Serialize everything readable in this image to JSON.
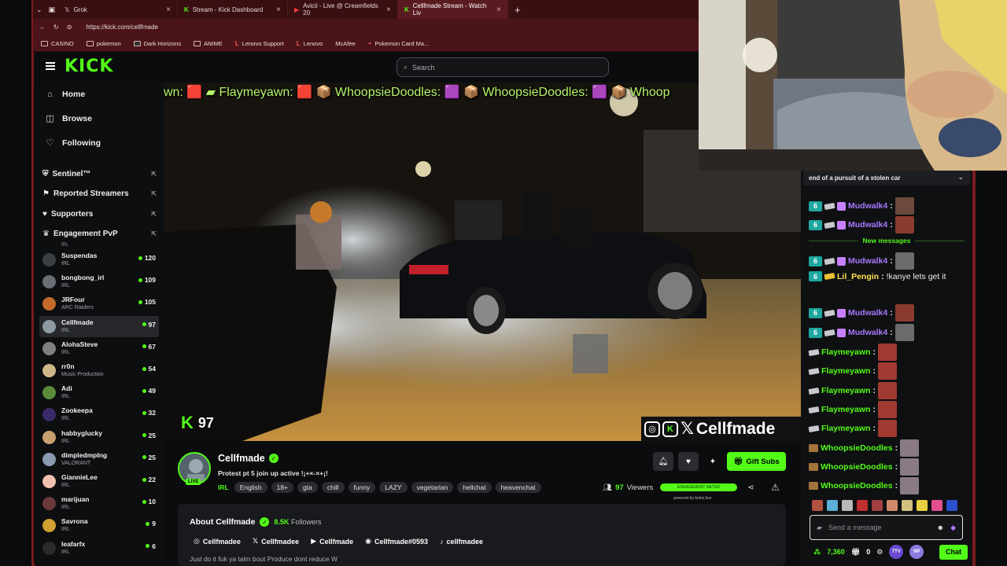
{
  "browser": {
    "tabs": [
      {
        "label": "Grok",
        "active": false
      },
      {
        "label": "Stream - Kick Dashboard",
        "active": false
      },
      {
        "label": "Avicii - Live @ Creamfields 20",
        "active": false
      },
      {
        "label": "Cellfmade Stream - Watch Liv",
        "active": true
      }
    ],
    "url": "https://kick.com/cellfmade",
    "bookmarks": [
      "CASINO",
      "pokemon",
      "Dark Horizons",
      "ANIME",
      "Lenovo Support",
      "Lenovo",
      "McAfee",
      "Pokemon Card Ma..."
    ]
  },
  "header": {
    "logo": "KICK",
    "search_placeholder": "Search"
  },
  "sidebar": {
    "nav": [
      {
        "label": "Home",
        "icon": "home-icon"
      },
      {
        "label": "Browse",
        "icon": "browse-icon"
      },
      {
        "label": "Following",
        "icon": "heart-icon"
      }
    ],
    "sections": [
      {
        "label": "Sentinel™"
      },
      {
        "label": "Reported Streamers"
      },
      {
        "label": "Supporters"
      },
      {
        "label": "Engagement PvP"
      }
    ],
    "partial_category": "IRL",
    "streamers": [
      {
        "name": "Suspendas",
        "category": "IRL",
        "viewers": "120"
      },
      {
        "name": "bongbong_irl",
        "category": "IRL",
        "viewers": "109"
      },
      {
        "name": "JRFour",
        "category": "ARC Raiders",
        "viewers": "105"
      },
      {
        "name": "Cellfmade",
        "category": "IRL",
        "viewers": "97"
      },
      {
        "name": "AlohaSteve",
        "category": "IRL",
        "viewers": "67"
      },
      {
        "name": "rr0n",
        "category": "Music Production",
        "viewers": "54"
      },
      {
        "name": "Adi",
        "category": "IRL",
        "viewers": "49"
      },
      {
        "name": "Zookeepa",
        "category": "IRL",
        "viewers": "32"
      },
      {
        "name": "habbyglucky",
        "category": "IRL",
        "viewers": "25"
      },
      {
        "name": "dimpledmpIng",
        "category": "VALORANT",
        "viewers": "25"
      },
      {
        "name": "GiannieLee",
        "category": "IRL",
        "viewers": "22"
      },
      {
        "name": "marijuan",
        "category": "IRL",
        "viewers": "10"
      },
      {
        "name": "Savrona",
        "category": "IRL",
        "viewers": "9"
      },
      {
        "name": "leafarfx",
        "category": "IRL",
        "viewers": "6"
      }
    ]
  },
  "video": {
    "ticker": "wn: 🟥 ▰ Flaymeyawn: 🟥 📦 WhoopsieDoodles: 🟪 📦 WhoopsieDoodles: 🟪 📦 Whoop",
    "viewer_overlay": "97",
    "social_overlay": "Cellfmade"
  },
  "channel": {
    "name": "Cellfmade",
    "live_badge": "LIVE",
    "title": "Protest pt 5 join up active !¡+×-×+¡!",
    "category": "IRL",
    "tags": [
      "English",
      "18+",
      "gta",
      "chill",
      "funny",
      "LAZY",
      "vegetarian",
      "hellchat",
      "heavenchat"
    ],
    "viewers": "97",
    "viewers_label": "Viewers",
    "gift_subs": "Gift Subs",
    "engagement_label": "ENGAGEMENT METER",
    "powered_by": "powered by botrix.live",
    "about_title": "About Cellfmade",
    "followers_count": "8.5K",
    "followers_label": "Followers",
    "links": [
      {
        "label": "Cellfmadee",
        "icon": "instagram-icon"
      },
      {
        "label": "Cellfmadee",
        "icon": "x-icon"
      },
      {
        "label": "Cellfmade",
        "icon": "youtube-icon"
      },
      {
        "label": "Cellfmade#0593",
        "icon": "discord-icon"
      },
      {
        "label": "cellfmadee",
        "icon": "tiktok-icon"
      }
    ],
    "bio": "Just do it fuk ya talm bout Produce dont reduce W"
  },
  "chat": {
    "pinned": "end of a pursuit of a stolen car",
    "new_messages": "New messages",
    "messages": [
      {
        "user": "Mudwalk4",
        "text": "",
        "color": "purple",
        "badges": [
          "6",
          "sk",
          "gift"
        ],
        "emote": "#6b4a3c"
      },
      {
        "user": "Mudwalk4",
        "text": "",
        "color": "purple",
        "badges": [
          "6",
          "sk",
          "gift"
        ],
        "emote": "#8a3a2e"
      },
      {
        "user": "Mudwalk4",
        "text": "",
        "color": "purple",
        "badges": [
          "6",
          "sk",
          "gift"
        ],
        "emote": "#6b6b6b"
      },
      {
        "user": "Lil_Pengin",
        "text": "!kanye lets get it",
        "color": "yellow",
        "badges": [
          "6",
          "card"
        ],
        "emote": ""
      },
      {
        "user": "Mudwalk4",
        "text": "",
        "color": "purple",
        "badges": [
          "6",
          "sk",
          "gift"
        ],
        "emote": "#8a3a2e"
      },
      {
        "user": "Mudwalk4",
        "text": "",
        "color": "purple",
        "badges": [
          "6",
          "sk",
          "gift"
        ],
        "emote": "#6b6b6b"
      },
      {
        "user": "Flaymeyawn",
        "text": "",
        "color": "green",
        "badges": [
          "sk"
        ],
        "emote": "#a03a30"
      },
      {
        "user": "Flaymeyawn",
        "text": "",
        "color": "green",
        "badges": [
          "sk"
        ],
        "emote": "#a03a30"
      },
      {
        "user": "Flaymeyawn",
        "text": "",
        "color": "green",
        "badges": [
          "sk"
        ],
        "emote": "#a03a30"
      },
      {
        "user": "Flaymeyawn",
        "text": "",
        "color": "green",
        "badges": [
          "sk"
        ],
        "emote": "#a03a30"
      },
      {
        "user": "Flaymeyawn",
        "text": "",
        "color": "green",
        "badges": [
          "sk"
        ],
        "emote": "#a03a30"
      },
      {
        "user": "WhoopsieDoodles",
        "text": "",
        "color": "green",
        "badges": [
          "box"
        ],
        "emote": "#8a7a86"
      },
      {
        "user": "WhoopsieDoodles",
        "text": "",
        "color": "green",
        "badges": [
          "box"
        ],
        "emote": "#8a7a86"
      },
      {
        "user": "WhoopsieDoodles",
        "text": "",
        "color": "green",
        "badges": [
          "box"
        ],
        "emote": "#8a7a86"
      }
    ],
    "input_placeholder": "Send a message",
    "points": "7,360",
    "gift_count": "0",
    "chat_button": "Chat"
  }
}
